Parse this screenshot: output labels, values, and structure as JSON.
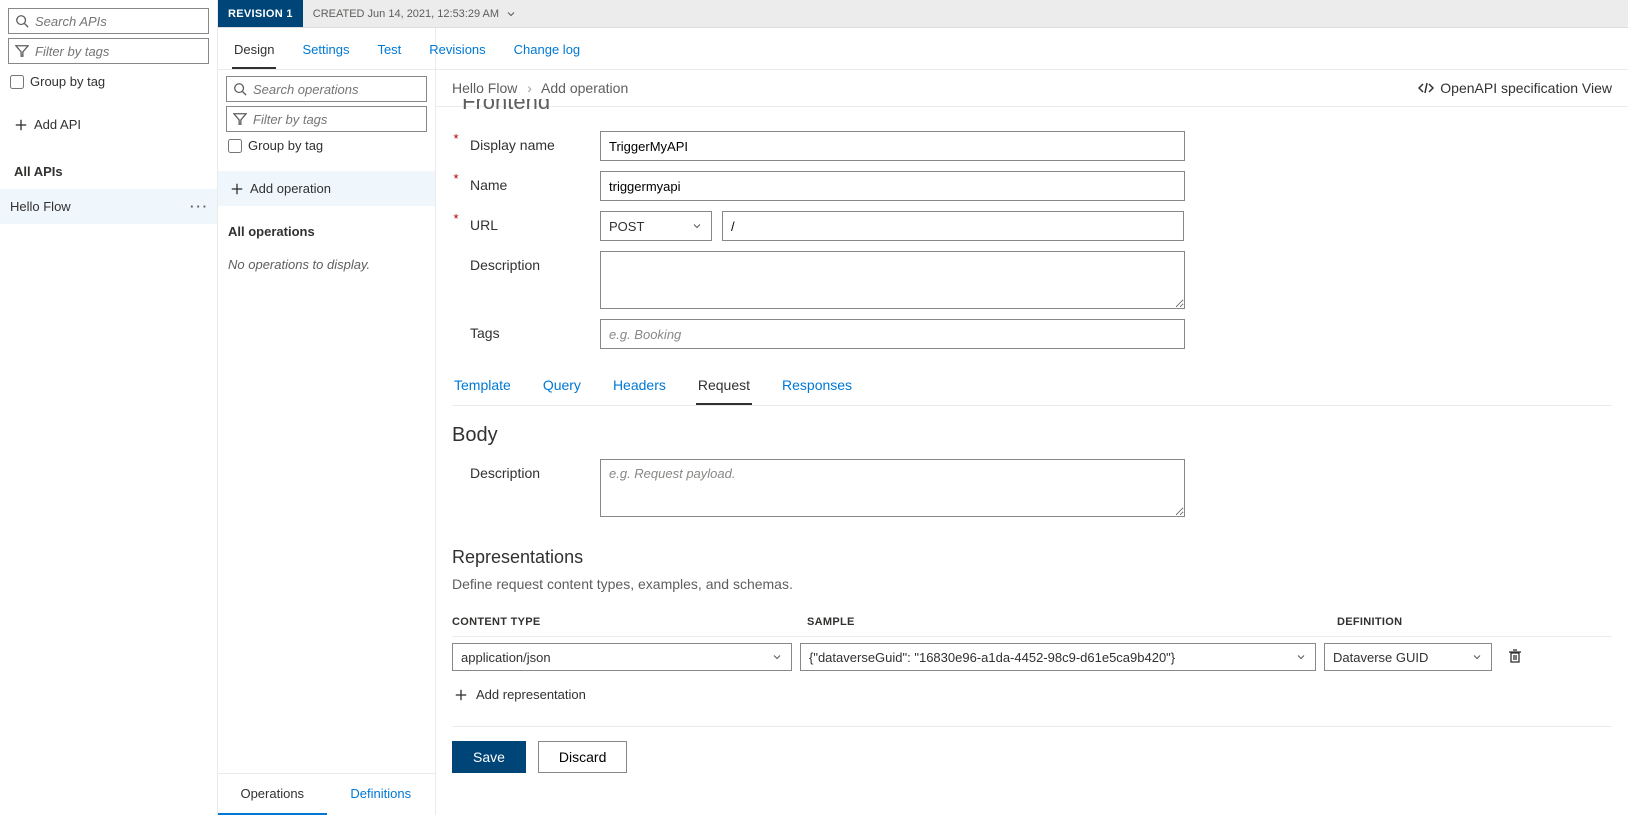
{
  "sidebar": {
    "search_apis_ph": "Search APIs",
    "filter_tags_ph": "Filter by tags",
    "group_by_tag": "Group by tag",
    "add_api": "Add API",
    "all_apis": "All APIs",
    "api_items": [
      "Hello Flow"
    ]
  },
  "ops": {
    "search_ops_ph": "Search operations",
    "filter_tags_ph": "Filter by tags",
    "group_by_tag": "Group by tag",
    "add_operation": "Add operation",
    "all_operations": "All operations",
    "empty": "No operations to display.",
    "footer_ops": "Operations",
    "footer_defs": "Definitions"
  },
  "rev": {
    "badge": "REVISION 1",
    "created": "CREATED Jun 14, 2021, 12:53:29 AM"
  },
  "tabs": {
    "design": "Design",
    "settings": "Settings",
    "test": "Test",
    "revisions": "Revisions",
    "changelog": "Change log"
  },
  "breadcrumb": {
    "a": "Hello Flow",
    "b": "Add operation"
  },
  "oapi_view": "OpenAPI specification View",
  "frontend_title": "Frontend",
  "labels": {
    "display_name": "Display name",
    "name": "Name",
    "url": "URL",
    "description": "Description",
    "tags": "Tags"
  },
  "values": {
    "display_name": "TriggerMyAPI",
    "name": "triggermyapi",
    "method": "POST",
    "url": "/",
    "tags_ph": "e.g. Booking"
  },
  "subtabs": {
    "template": "Template",
    "query": "Query",
    "headers": "Headers",
    "request": "Request",
    "responses": "Responses"
  },
  "body": {
    "heading": "Body",
    "description_label": "Description",
    "description_ph": "e.g. Request payload."
  },
  "reps": {
    "heading": "Representations",
    "help": "Define request content types, examples, and schemas.",
    "col_ct": "CONTENT TYPE",
    "col_sample": "SAMPLE",
    "col_def": "DEFINITION",
    "row": {
      "content_type": "application/json",
      "sample": "{\"dataverseGuid\": \"16830e96-a1da-4452-98c9-d61e5ca9b420\"}",
      "definition": "Dataverse GUID"
    },
    "add": "Add representation"
  },
  "actions": {
    "save": "Save",
    "discard": "Discard"
  }
}
